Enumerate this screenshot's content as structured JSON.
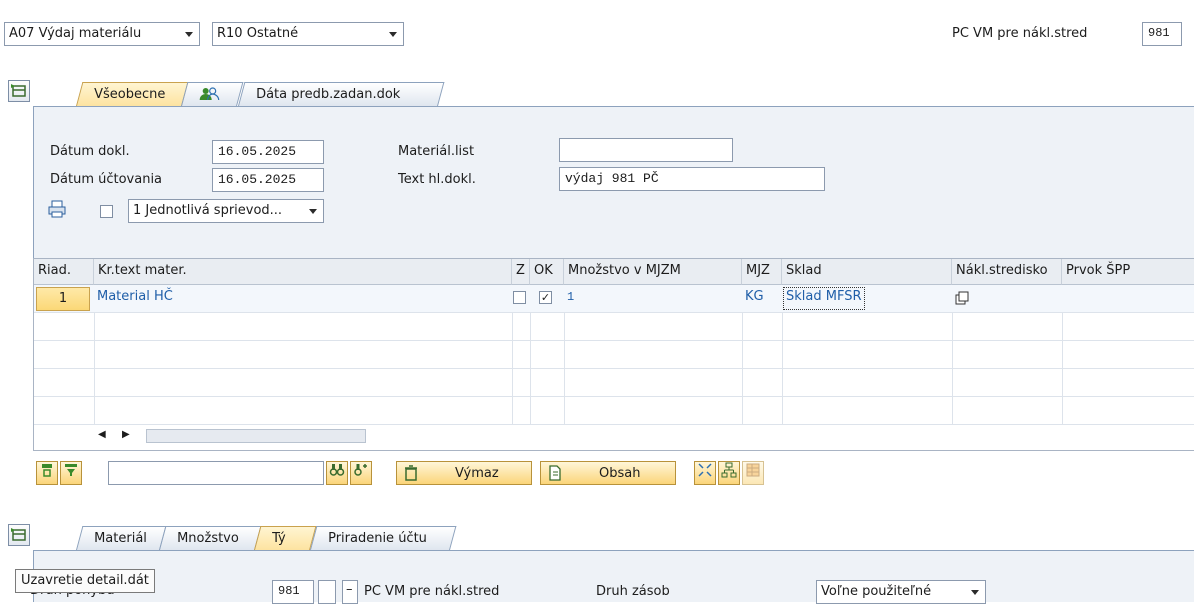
{
  "header": {
    "movement_type": "A07 Výdaj materiálu",
    "reference": "R10 Ostatné",
    "pc_label": "PC VM pre nákl.stred",
    "pc_value": "981"
  },
  "upper_tabs": [
    {
      "label": "Všeobecne"
    },
    {
      "label": ""
    },
    {
      "label": "Dáta predb.zadan.dok"
    }
  ],
  "general": {
    "doc_date_label": "Dátum dokl.",
    "doc_date_value": "16.05.2025",
    "posting_date_label": "Dátum účtovania",
    "posting_date_value": "16.05.2025",
    "material_slip_label": "Materiál.list",
    "material_slip_value": "",
    "header_text_label": "Text hl.dokl.",
    "header_text_value": "výdaj 981 PČ",
    "print_option": "1 Jednotlivá sprievod..."
  },
  "table": {
    "columns": [
      "Riad.",
      "Kr.text mater.",
      "Z",
      "OK",
      "Množstvo v MJZM",
      "MJZ",
      "Sklad",
      "Nákl.stredisko",
      "Prvok ŠPP"
    ],
    "rows": [
      {
        "line": "1",
        "material": "Material HČ",
        "z": false,
        "ok": true,
        "qty": "1",
        "unit": "KG",
        "storage": "Sklad MFSR",
        "cost_center": "",
        "wbs": ""
      }
    ]
  },
  "toolbar": {
    "delete_label": "Výmaz",
    "contents_label": "Obsah",
    "search_value": ""
  },
  "lower_tabs": [
    {
      "label": "Materiál"
    },
    {
      "label": "Množstvo"
    },
    {
      "label": "Tý"
    },
    {
      "label": "Priradenie účtu"
    }
  ],
  "detail": {
    "tooltip": "Uzavretie detail.dát",
    "movement_label": "Druh pohybu",
    "movement_value": "981",
    "minus_sign": "–",
    "pc_label": "PC VM pre nákl.stred",
    "stock_type_label": "Druh zásob",
    "stock_type_value": "Voľne použiteľné"
  },
  "colors": {
    "accent_yellow": "#fbd57a",
    "panel_bg": "#eef2f7",
    "link_blue": "#1f5ea8"
  },
  "icons": [
    "expand-icon",
    "people-icon",
    "printer-icon",
    "copy-icon",
    "binoculars-icon",
    "find-next-icon",
    "trash-icon",
    "document-icon",
    "expand-all-icon",
    "hierarchy-icon",
    "grid-icon",
    "align-top-icon",
    "filter-icon"
  ]
}
